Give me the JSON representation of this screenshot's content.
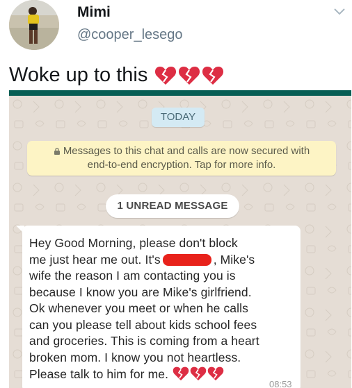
{
  "tweet": {
    "name": "Mimi",
    "handle": "@cooper_lesego",
    "text": "Woke up to this",
    "text_emoji": [
      "broken-heart",
      "broken-heart",
      "broken-heart"
    ],
    "menu_icon": "chevron-down-icon"
  },
  "whatsapp": {
    "date_chip": "TODAY",
    "encryption_line1": "Messages to this chat and calls are now secured with",
    "encryption_line2": "end-to-end encryption. Tap for more info.",
    "unread_chip": "1 UNREAD MESSAGE",
    "message": {
      "lines": [
        "Hey Good Morning, please don't block",
        "me just hear me out. It's",
        ", Mike's",
        "wife the reason I am contacting you is",
        "because I know you are Mike's girlfriend.",
        "Ok whenever you meet or when he calls",
        "can you please tell about kids school fees",
        "and groceries. This is coming from a heart",
        "broken mom. I know you not heartless.",
        "Please talk to him for me."
      ],
      "emoji": [
        "broken-heart",
        "broken-heart",
        "broken-heart"
      ],
      "time": "08:53"
    },
    "colors": {
      "header": "#075e54",
      "background": "#e5ddd5",
      "date_chip": "#d4eaf4",
      "encryption_chip": "#fdf4c5",
      "redaction": "#e8221b"
    }
  }
}
